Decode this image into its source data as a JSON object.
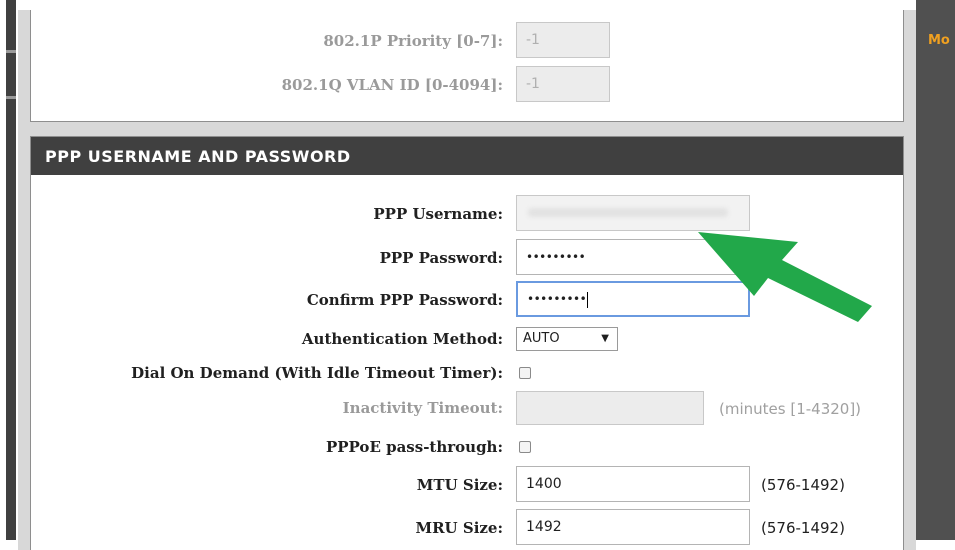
{
  "vlan_section": {
    "priority_label": "802.1P Priority [0-7]:",
    "priority_value": "-1",
    "vlan_id_label": "802.1Q VLAN ID [0-4094]:",
    "vlan_id_value": "-1"
  },
  "ppp_section": {
    "title": "PPP USERNAME AND PASSWORD",
    "username_label": "PPP Username:",
    "username_value": "",
    "password_label": "PPP Password:",
    "password_value": "•••••••••",
    "confirm_label": "Confirm PPP Password:",
    "confirm_value": "•••••••••",
    "auth_label": "Authentication Method:",
    "auth_value": "AUTO",
    "dial_label": "Dial On Demand (With Idle Timeout Timer):",
    "dial_checked": false,
    "inactivity_label": "Inactivity Timeout:",
    "inactivity_value": "",
    "inactivity_hint": "(minutes [1-4320])",
    "pppoe_label": "PPPoE pass-through:",
    "pppoe_checked": false,
    "mtu_label": "MTU Size:",
    "mtu_value": "1400",
    "mtu_hint": "(576-1492)",
    "mru_label": "MRU Size:",
    "mru_value": "1492",
    "mru_hint": "(576-1492)"
  },
  "sidebar": {
    "more_text": "Mo"
  },
  "annotation": {
    "arrow_color": "#22a84a",
    "arrow_icon": "arrow-pointing-to-username"
  },
  "colors": {
    "header_bg": "#404040",
    "focus_border": "#6a9ae0",
    "accent": "#f0a020"
  }
}
